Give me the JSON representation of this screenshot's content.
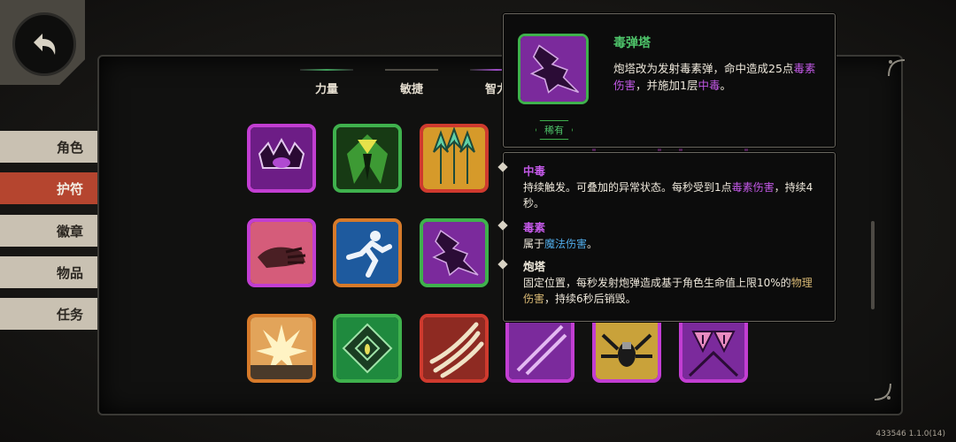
{
  "side_tabs": [
    {
      "label": "角色",
      "active": false
    },
    {
      "label": "护符",
      "active": true
    },
    {
      "label": "徽章",
      "active": false
    },
    {
      "label": "物品",
      "active": false
    },
    {
      "label": "任务",
      "active": false
    }
  ],
  "stat_tabs": [
    "力量",
    "敏捷",
    "智力"
  ],
  "icons": [
    {
      "name": "purple-crown-icon",
      "rarity_color": "#c23ed2"
    },
    {
      "name": "green-cloak-icon",
      "rarity_color": "#3fb14d"
    },
    {
      "name": "arrows-up-icon",
      "rarity_color": "#cf3a2e"
    },
    {
      "name": "hand-grab-icon",
      "rarity_color": "#c23ed2"
    },
    {
      "name": "runner-icon",
      "rarity_color": "#d67a2a"
    },
    {
      "name": "poison-tower-icon",
      "rarity_color": "#3fb14d"
    },
    {
      "name": "explosion-icon",
      "rarity_color": "#d67a2a"
    },
    {
      "name": "green-rune-icon",
      "rarity_color": "#3fb14d"
    },
    {
      "name": "claw-slash-icon",
      "rarity_color": "#cf3a2e"
    },
    {
      "name": "purple-spear-icon",
      "rarity_color": "#c23ed2"
    },
    {
      "name": "spider-icon",
      "rarity_color": "#c23ed2"
    },
    {
      "name": "warning-triangles-icon",
      "rarity_color": "#c23ed2"
    }
  ],
  "tooltip": {
    "title": "毒弹塔",
    "desc_1": "炮塔改为发射毒素弹，命中造成25点",
    "desc_hl_1": "毒素伤害",
    "desc_2": "，并施加1层",
    "desc_hl_2": "中毒",
    "desc_3": "。",
    "rarity": "稀有"
  },
  "keywords": [
    {
      "term": "中毒",
      "text_1": "持续触发。可叠加的异常状态。每秒受到1点",
      "hl": "毒素伤害",
      "text_2": "，持续4秒。"
    },
    {
      "term": "毒素",
      "text_1": "属于",
      "hl": "魔法伤害",
      "text_2": "。"
    },
    {
      "term": "炮塔",
      "text_1": "固定位置，每秒发射炮弹造成基于角色生命值上限10%的",
      "hl": "物理伤害",
      "text_2": "，持续6秒后销毁。"
    }
  ],
  "version": "433546 1.1.0(14)",
  "colors": {
    "accent_green": "#4ec46a",
    "poison": "#c258e6",
    "magic": "#4fa9e6",
    "active_tab": "#b5452f"
  }
}
